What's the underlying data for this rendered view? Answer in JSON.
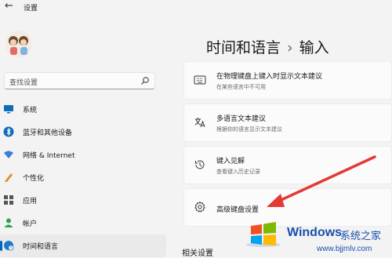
{
  "window": {
    "back_glyph": "←",
    "title": "设置"
  },
  "search": {
    "placeholder": "查找设置"
  },
  "sidebar": {
    "items": [
      {
        "label": "系统",
        "icon": "monitor-icon",
        "color": "#0f6cbd"
      },
      {
        "label": "蓝牙和其他设备",
        "icon": "bluetooth-icon",
        "color": "#0f6cbd"
      },
      {
        "label": "网络 & Internet",
        "icon": "wifi-icon",
        "color": "#3a7fd5"
      },
      {
        "label": "个性化",
        "icon": "pen-icon",
        "color": "#e0902a"
      },
      {
        "label": "应用",
        "icon": "apps-icon",
        "color": "#555555"
      },
      {
        "label": "帐户",
        "icon": "user-icon",
        "color": "#2f9e58"
      },
      {
        "label": "时间和语言",
        "icon": "globe-clock-icon",
        "color": "#1f78c8",
        "active": true
      }
    ]
  },
  "header": {
    "part1": "时间和语言",
    "separator": "›",
    "part2": "输入"
  },
  "cards": [
    {
      "title": "在物理键盘上键入时显示文本建议",
      "subtitle": "在某些语言中不可用",
      "icon": "keyboard-icon"
    },
    {
      "title": "多语言文本建议",
      "subtitle": "根据你的语言显示文本建议",
      "icon": "multilingual-icon"
    },
    {
      "title": "键入见解",
      "subtitle": "查看键入历史记录",
      "icon": "history-icon"
    },
    {
      "title": "高级键盘设置",
      "subtitle": "",
      "icon": "gear-icon"
    }
  ],
  "related": {
    "title": "相关设置"
  },
  "watermark": {
    "brand": "Windows",
    "cn": "系统之家",
    "url": "www.bjjmlv.com"
  },
  "colors": {
    "accent": "#0067c0",
    "arrow": "#e53935"
  }
}
